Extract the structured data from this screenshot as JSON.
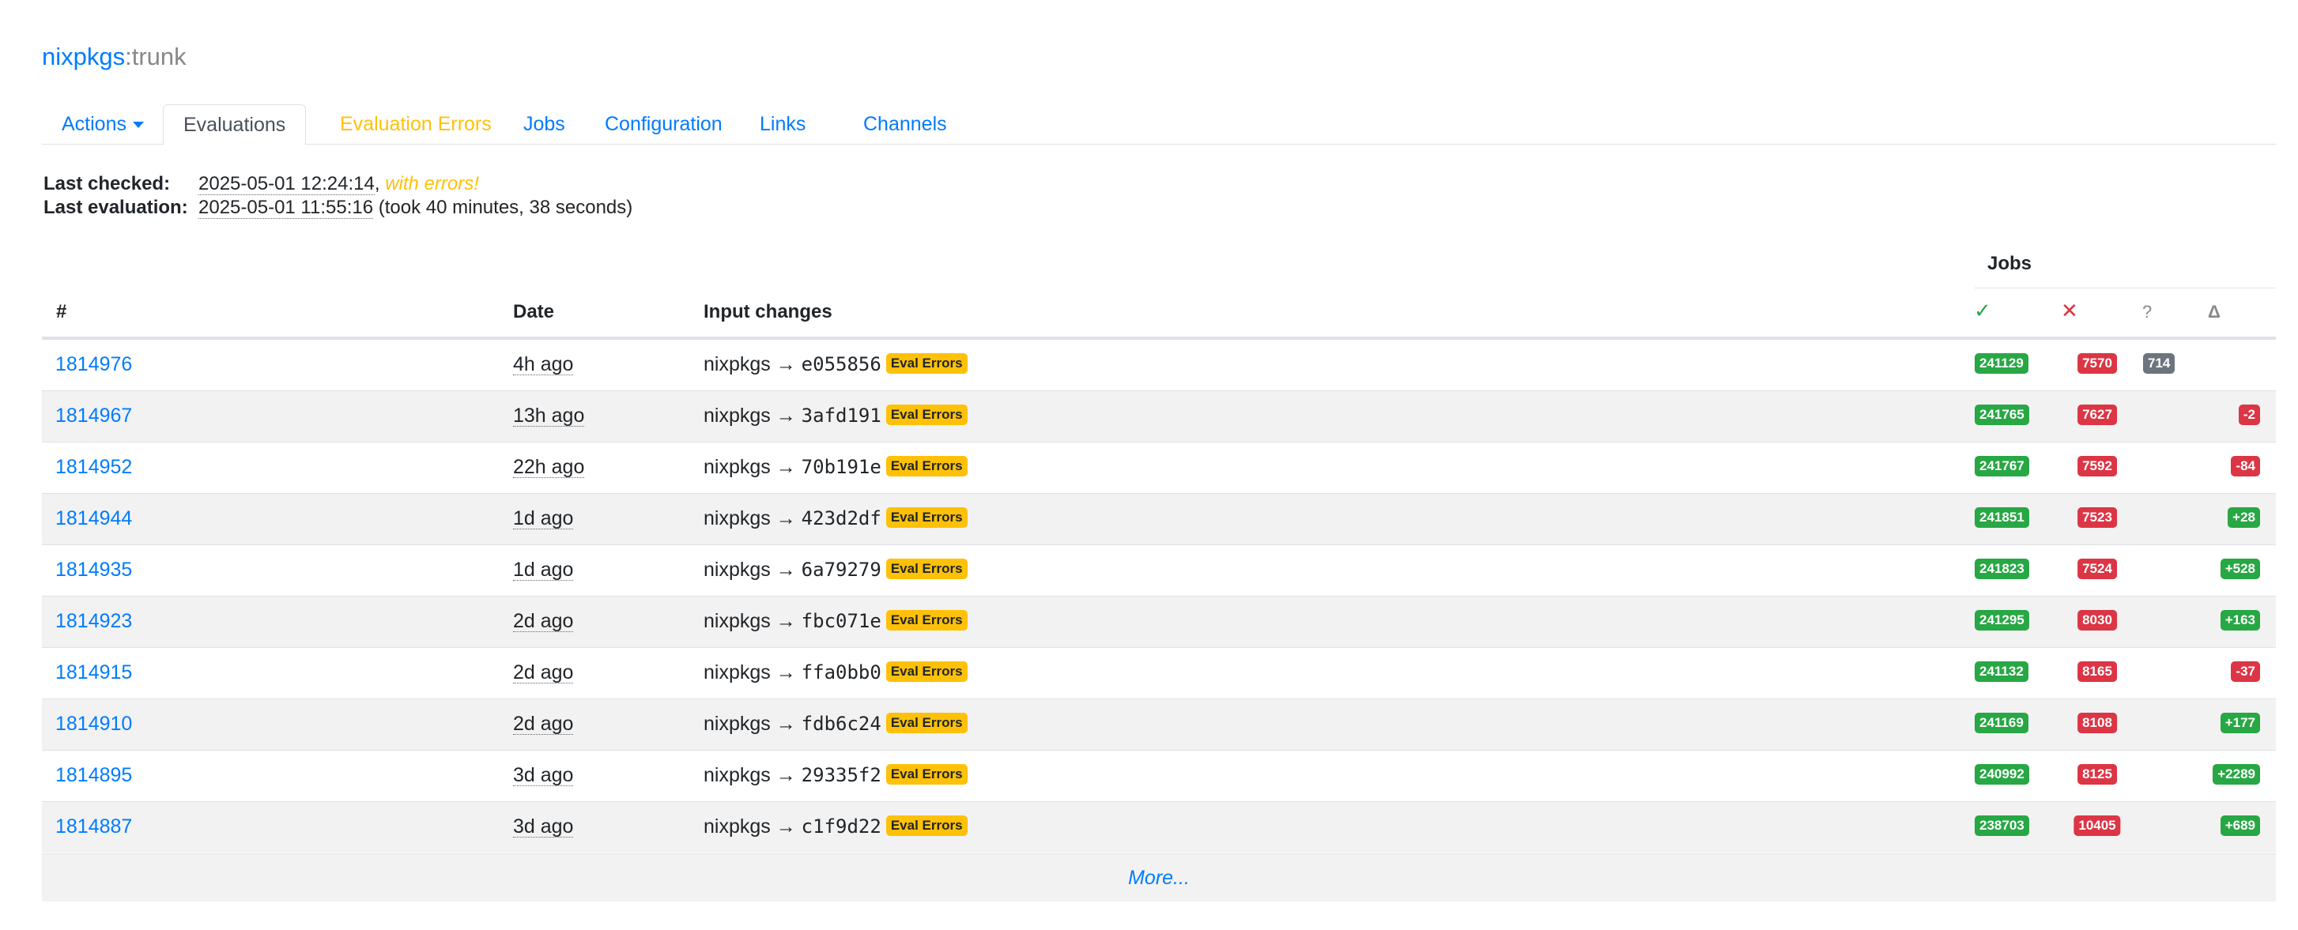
{
  "header": {
    "project": "nixpkgs",
    "separator": ":",
    "jobset": "trunk"
  },
  "tabs": [
    {
      "label": "Actions",
      "caret": true
    },
    {
      "label": "Evaluations",
      "active": true
    },
    {
      "label": "Evaluation Errors",
      "warning": true
    },
    {
      "label": "Jobs"
    },
    {
      "label": "Configuration"
    },
    {
      "label": "Links"
    },
    {
      "label": "Channels"
    }
  ],
  "info": {
    "last_checked_label": "Last checked:",
    "last_checked_value": "2025-05-01 12:24:14",
    "last_checked_suffix": ",",
    "last_checked_error": "with errors!",
    "last_eval_label": "Last evaluation:",
    "last_eval_value": "2025-05-01 11:55:16",
    "last_eval_suffix": "(took 40 minutes, 38 seconds)"
  },
  "table": {
    "jobs_header": "Jobs",
    "columns": {
      "id": "#",
      "date": "Date",
      "input": "Input changes"
    },
    "job_icons": {
      "succeeded": "✓",
      "failed": "✕",
      "queued": "?",
      "delta": "Δ"
    },
    "arrow": "→",
    "eval_errors_label": "Eval Errors",
    "rows": [
      {
        "id": "1814976",
        "date": "4h ago",
        "input": "nixpkgs",
        "rev": "e055856",
        "succeeded": "241129",
        "failed": "7570",
        "queued": "714",
        "delta": ""
      },
      {
        "id": "1814967",
        "date": "13h ago",
        "input": "nixpkgs",
        "rev": "3afd191",
        "succeeded": "241765",
        "failed": "7627",
        "queued": "",
        "delta": "-2"
      },
      {
        "id": "1814952",
        "date": "22h ago",
        "input": "nixpkgs",
        "rev": "70b191e",
        "succeeded": "241767",
        "failed": "7592",
        "queued": "",
        "delta": "-84"
      },
      {
        "id": "1814944",
        "date": "1d ago",
        "input": "nixpkgs",
        "rev": "423d2df",
        "succeeded": "241851",
        "failed": "7523",
        "queued": "",
        "delta": "+28"
      },
      {
        "id": "1814935",
        "date": "1d ago",
        "input": "nixpkgs",
        "rev": "6a79279",
        "succeeded": "241823",
        "failed": "7524",
        "queued": "",
        "delta": "+528"
      },
      {
        "id": "1814923",
        "date": "2d ago",
        "input": "nixpkgs",
        "rev": "fbc071e",
        "succeeded": "241295",
        "failed": "8030",
        "queued": "",
        "delta": "+163"
      },
      {
        "id": "1814915",
        "date": "2d ago",
        "input": "nixpkgs",
        "rev": "ffa0bb0",
        "succeeded": "241132",
        "failed": "8165",
        "queued": "",
        "delta": "-37"
      },
      {
        "id": "1814910",
        "date": "2d ago",
        "input": "nixpkgs",
        "rev": "fdb6c24",
        "succeeded": "241169",
        "failed": "8108",
        "queued": "",
        "delta": "+177"
      },
      {
        "id": "1814895",
        "date": "3d ago",
        "input": "nixpkgs",
        "rev": "29335f2",
        "succeeded": "240992",
        "failed": "8125",
        "queued": "",
        "delta": "+2289"
      },
      {
        "id": "1814887",
        "date": "3d ago",
        "input": "nixpkgs",
        "rev": "c1f9d22",
        "succeeded": "238703",
        "failed": "10405",
        "queued": "",
        "delta": "+689"
      }
    ],
    "more_label": "More..."
  },
  "colors": {
    "link": "#007bff",
    "warning": "#ffc107",
    "success": "#28a745",
    "danger": "#dc3545",
    "secondary": "#6c757d"
  }
}
